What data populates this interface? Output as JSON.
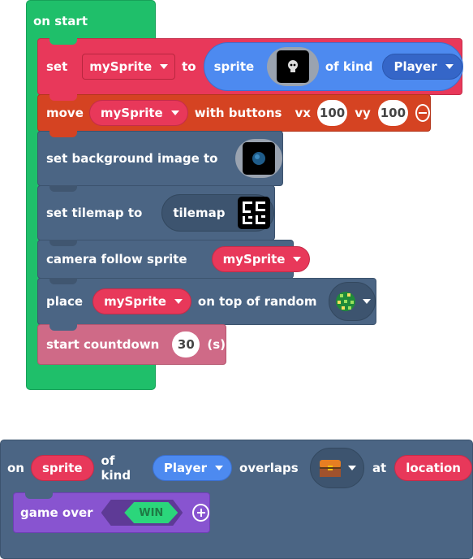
{
  "on_start": {
    "label": "on start"
  },
  "set_block": {
    "set": "set",
    "var": "mySprite",
    "to": "to",
    "sprite": "sprite",
    "of_kind": "of kind",
    "kind": "Player"
  },
  "move_block": {
    "move": "move",
    "var": "mySprite",
    "with_buttons": "with buttons",
    "vx_label": "vx",
    "vx": "100",
    "vy_label": "vy",
    "vy": "100"
  },
  "bg_block": {
    "label": "set background image to"
  },
  "tilemap_block": {
    "label": "set tilemap to",
    "value": "tilemap"
  },
  "camera_block": {
    "label": "camera follow sprite",
    "var": "mySprite"
  },
  "place_block": {
    "place": "place",
    "var": "mySprite",
    "on_top": "on top of random"
  },
  "countdown_block": {
    "label": "start countdown",
    "value": "30",
    "unit": "(s)"
  },
  "overlap_event": {
    "on": "on",
    "sprite": "sprite",
    "of_kind": "of kind",
    "kind": "Player",
    "overlaps": "overlaps",
    "at": "at",
    "location": "location"
  },
  "game_over_block": {
    "label": "game over",
    "result": "WIN"
  },
  "colors": {
    "event_green": "#1fbf6a",
    "sprites_red": "#e8385a",
    "controller_orange": "#d54322",
    "scene_blue": "#4b6584",
    "info_pink": "#cf6a87",
    "game_purple": "#8854d0",
    "sprite_pill": "#4d8af0"
  }
}
